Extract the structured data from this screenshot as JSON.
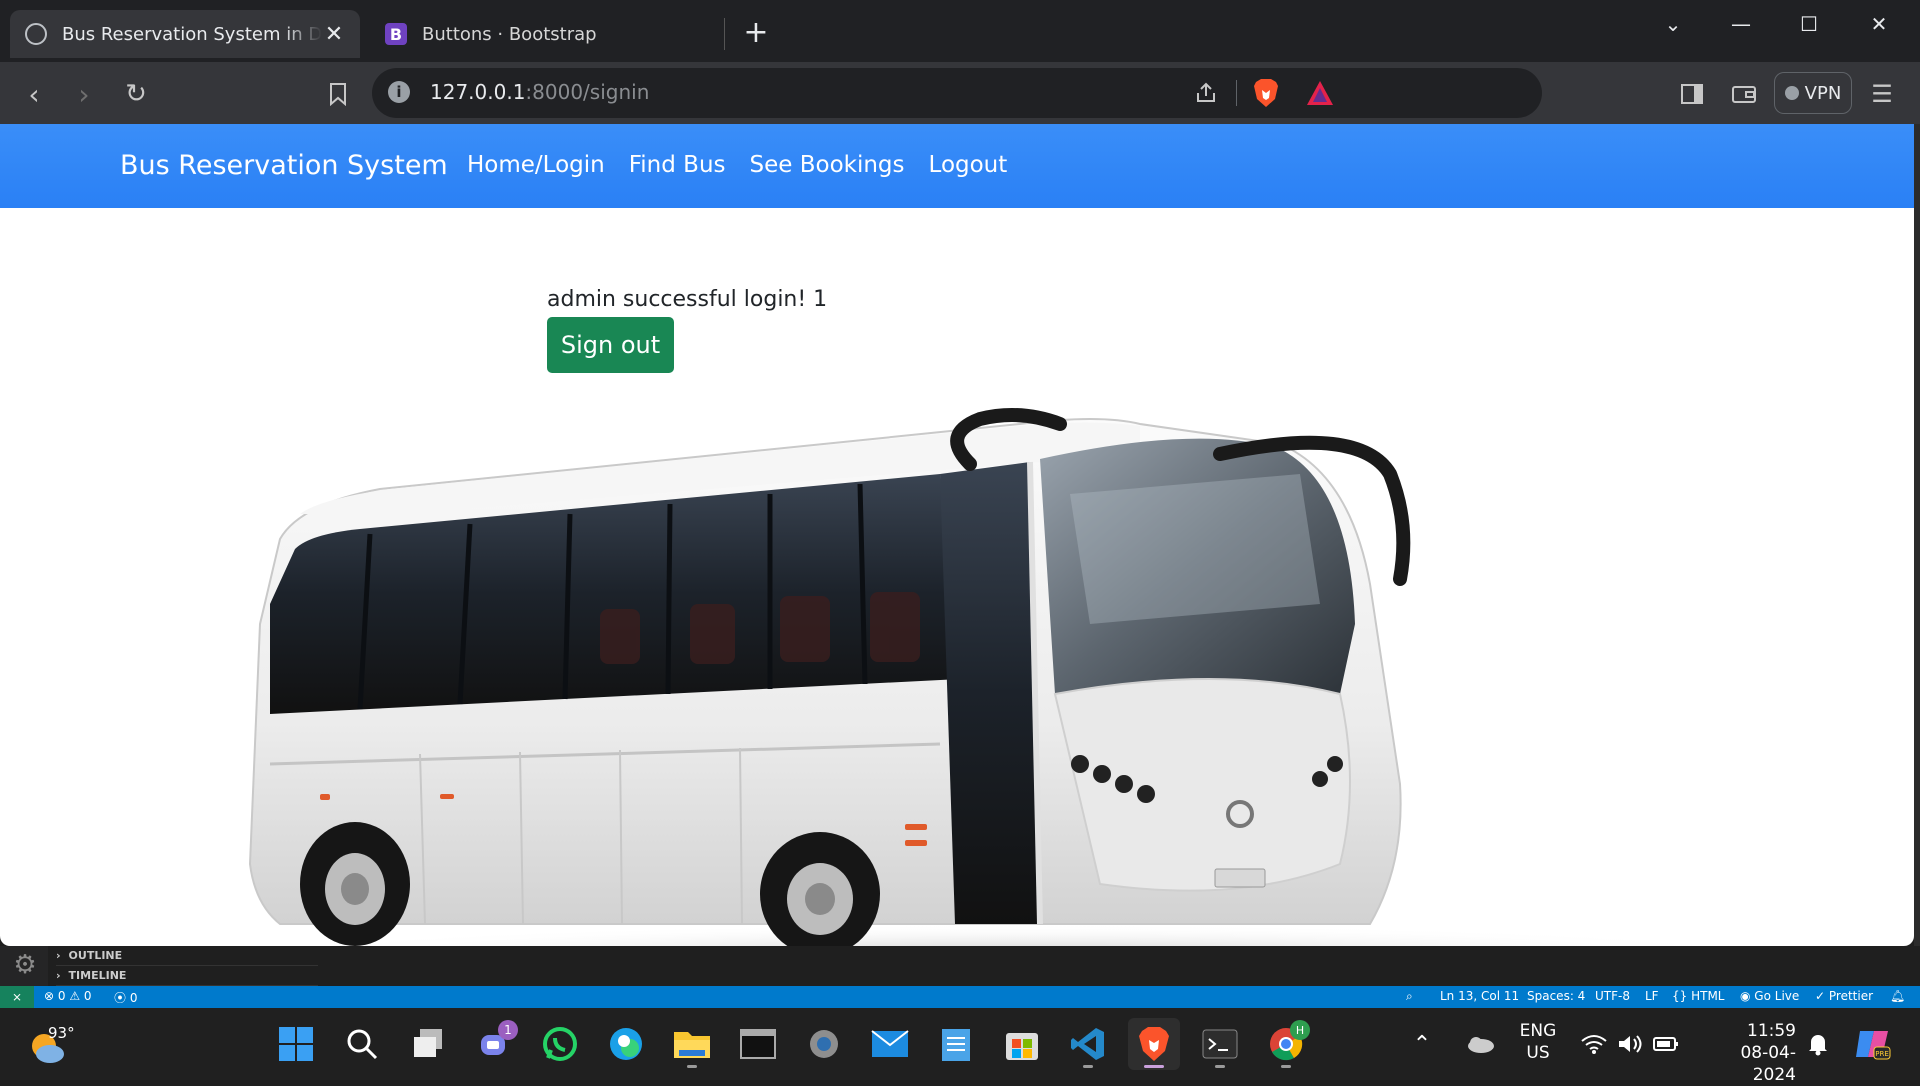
{
  "browser": {
    "tabs": [
      {
        "title": "Bus Reservation System in Django",
        "active": true
      },
      {
        "title": "Buttons · Bootstrap",
        "active": false,
        "favicon_letter": "B"
      }
    ],
    "url_host": "127.0.0.1",
    "url_rest": ":8000/signin",
    "vpn_label": "VPN"
  },
  "page": {
    "brand": "Bus Reservation System",
    "nav": [
      "Home/Login",
      "Find Bus",
      "See Bookings",
      "Logout"
    ],
    "message": "admin successful login! 1",
    "signout_label": "Sign out",
    "navbar_color": "#2d86f8",
    "button_color": "#198754"
  },
  "vscode": {
    "panels": [
      "OUTLINE",
      "TIMELINE"
    ],
    "status_left": {
      "errors": "0",
      "warnings": "0",
      "ports": "0"
    },
    "status_right": [
      "Ln 13, Col 11",
      "Spaces: 4",
      "UTF-8",
      "LF",
      "{} HTML",
      "Go Live",
      "Prettier"
    ]
  },
  "taskbar": {
    "weather_temp": "93°",
    "chat_badge": "1",
    "chrome_badge": "H",
    "lang_line1": "ENG",
    "lang_line2": "US",
    "time": "11:59",
    "date": "08-04-2024"
  }
}
